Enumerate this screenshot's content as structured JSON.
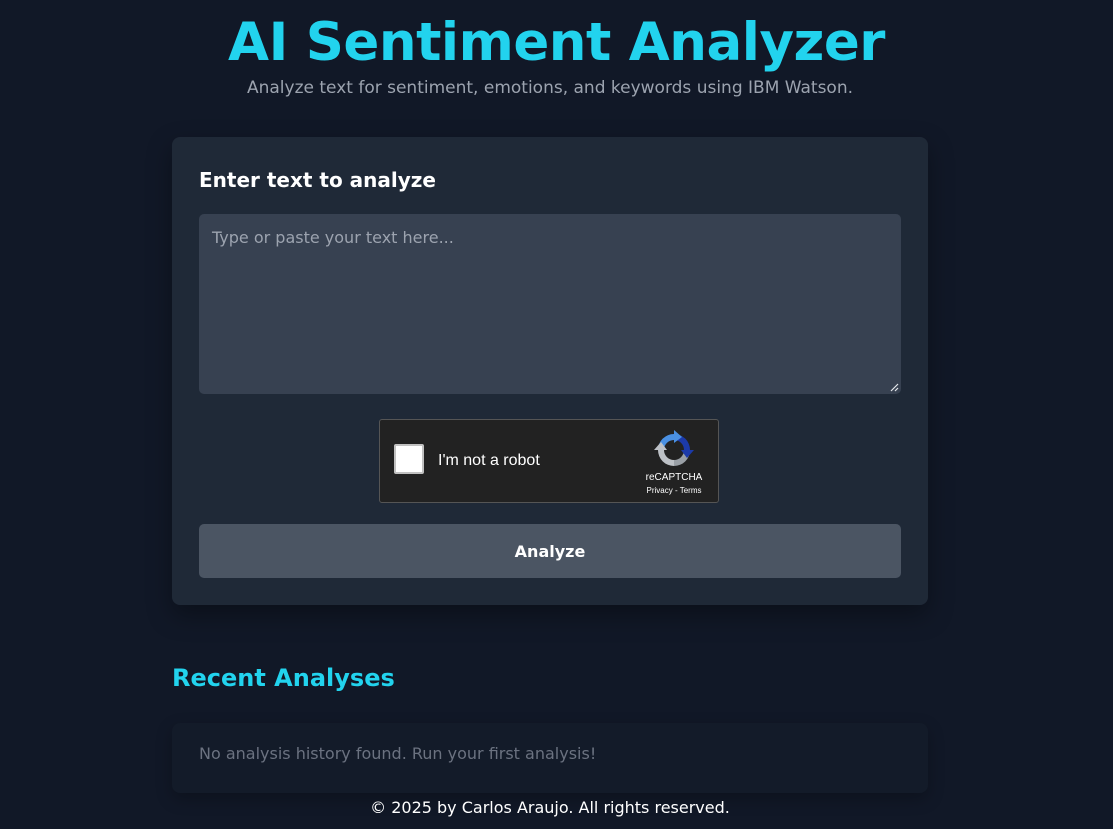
{
  "header": {
    "title": "AI Sentiment Analyzer",
    "subtitle": "Analyze text for sentiment, emotions, and keywords using IBM Watson."
  },
  "analyzer": {
    "heading": "Enter text to analyze",
    "input_value": "",
    "input_placeholder": "Type or paste your text here...",
    "recaptcha": {
      "label": "I'm not a robot",
      "brand": "reCAPTCHA",
      "privacy_link": "Privacy",
      "separator": " - ",
      "terms_link": "Terms",
      "logo_icon": "recaptcha-logo-icon"
    },
    "analyze_button": "Analyze"
  },
  "history": {
    "title": "Recent Analyses",
    "empty_message": "No analysis history found. Run your first analysis!"
  },
  "footer": {
    "text": "© 2025 by Carlos Araujo. All rights reserved."
  },
  "colors": {
    "background": "#111827",
    "card": "#1f2937",
    "input": "#374151",
    "accent": "#22d3ee",
    "button": "#4b5563",
    "muted_text": "#9ca3af"
  }
}
